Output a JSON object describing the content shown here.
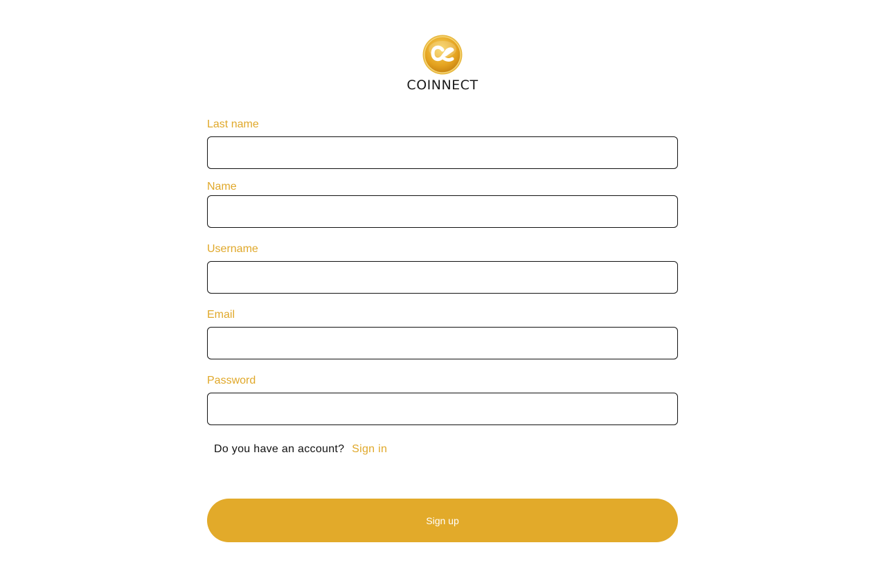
{
  "brand": {
    "name": "COINNECT",
    "logo_icon": "coinnect-coin-logo-icon",
    "accent_color": "#e2aa2a"
  },
  "form": {
    "fields": [
      {
        "label": "Last name",
        "value": "",
        "placeholder": ""
      },
      {
        "label": "Name",
        "value": "",
        "placeholder": ""
      },
      {
        "label": "Username",
        "value": "",
        "placeholder": ""
      },
      {
        "label": "Email",
        "value": "",
        "placeholder": ""
      },
      {
        "label": "Password",
        "value": "",
        "placeholder": ""
      }
    ],
    "account_prompt": "Do you have an account?",
    "signin_link": "Sign in",
    "submit_label": "Sign up"
  }
}
